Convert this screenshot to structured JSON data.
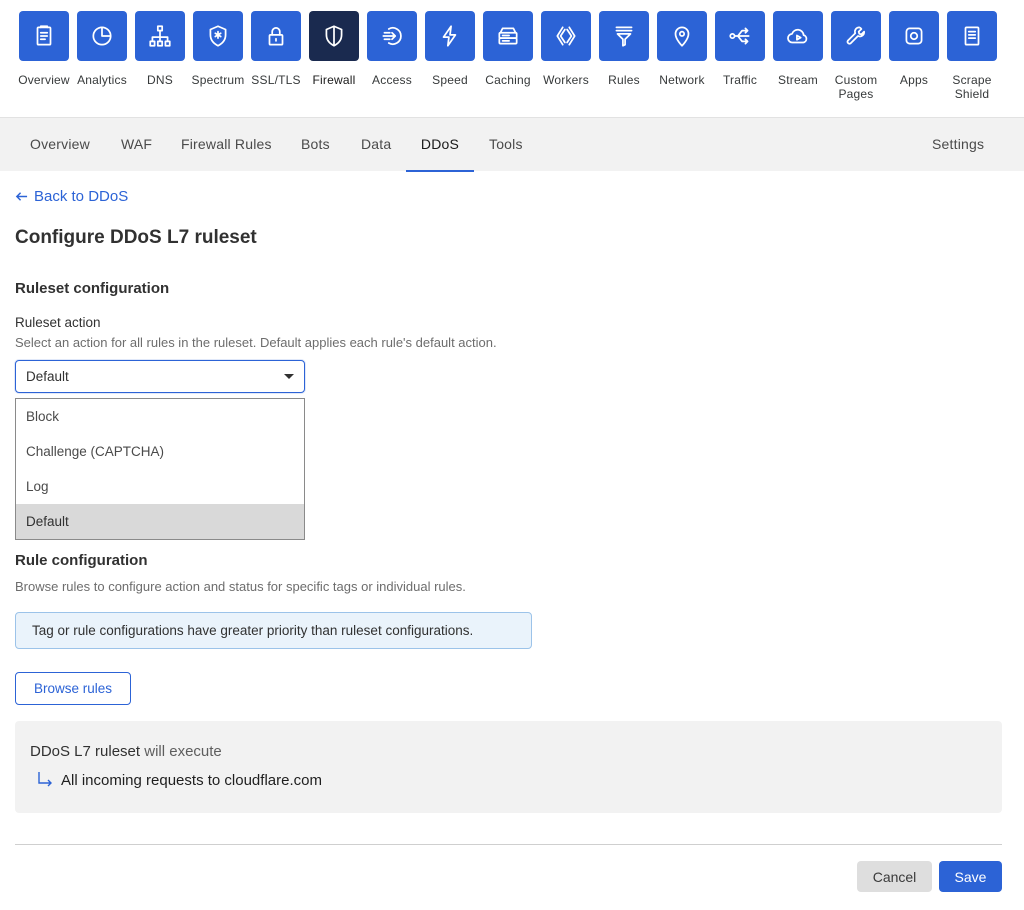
{
  "topnav": {
    "items": [
      {
        "label": "Overview",
        "icon": "clipboard-icon"
      },
      {
        "label": "Analytics",
        "icon": "pie-chart-icon"
      },
      {
        "label": "DNS",
        "icon": "network-tree-icon"
      },
      {
        "label": "Spectrum",
        "icon": "shield-star-icon"
      },
      {
        "label": "SSL/TLS",
        "icon": "lock-icon"
      },
      {
        "label": "Firewall",
        "icon": "shield-icon"
      },
      {
        "label": "Access",
        "icon": "sign-in-icon"
      },
      {
        "label": "Speed",
        "icon": "lightning-icon"
      },
      {
        "label": "Caching",
        "icon": "server-icon"
      },
      {
        "label": "Workers",
        "icon": "workers-icon"
      },
      {
        "label": "Rules",
        "icon": "filter-icon"
      },
      {
        "label": "Network",
        "icon": "location-pin-icon"
      },
      {
        "label": "Traffic",
        "icon": "share-icon"
      },
      {
        "label": "Stream",
        "icon": "cloud-play-icon"
      },
      {
        "label": "Custom\nPages",
        "icon": "wrench-icon"
      },
      {
        "label": "Apps",
        "icon": "apps-icon"
      },
      {
        "label": "Scrape\nShield",
        "icon": "document-icon"
      }
    ],
    "active": "Firewall",
    "accent_color": "#2c63d6",
    "active_color": "#1a2a4f"
  },
  "subnav": {
    "tabs": [
      "Overview",
      "WAF",
      "Firewall Rules",
      "Bots",
      "Data",
      "DDoS",
      "Tools"
    ],
    "active": "DDoS",
    "settings_label": "Settings"
  },
  "page": {
    "back_link": "Back to DDoS",
    "title": "Configure DDoS L7 ruleset",
    "ruleset_section": {
      "title": "Ruleset configuration",
      "action_label": "Ruleset action",
      "action_help": "Select an action for all rules in the ruleset. Default applies each rule's default action.",
      "selected_value": "Default",
      "options": [
        "Block",
        "Challenge (CAPTCHA)",
        "Log",
        "Default"
      ]
    },
    "rule_section": {
      "title": "Rule configuration",
      "help": "Browse rules to configure action and status for specific tags or individual rules.",
      "callout": "Tag or rule configurations have greater priority than ruleset configurations.",
      "browse_button": "Browse rules"
    },
    "execution": {
      "ruleset_name": "DDoS L7 ruleset",
      "suffix": "will execute",
      "target": "All incoming requests to cloudflare.com"
    },
    "actions": {
      "cancel": "Cancel",
      "save": "Save"
    }
  }
}
